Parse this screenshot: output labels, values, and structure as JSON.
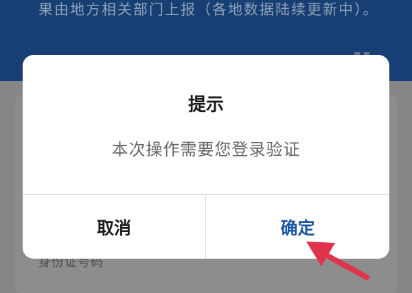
{
  "background": {
    "header_text": "果由地方相关部门上报（各地数据陆续更新中）。",
    "field_label": "身份证号码"
  },
  "dialog": {
    "title": "提示",
    "message": "本次操作需要您登录验证",
    "cancel_label": "取消",
    "confirm_label": "确定"
  },
  "colors": {
    "header_bg": "#173f73",
    "confirm_text": "#1a57a0",
    "annotation_arrow": "#e0324a"
  }
}
